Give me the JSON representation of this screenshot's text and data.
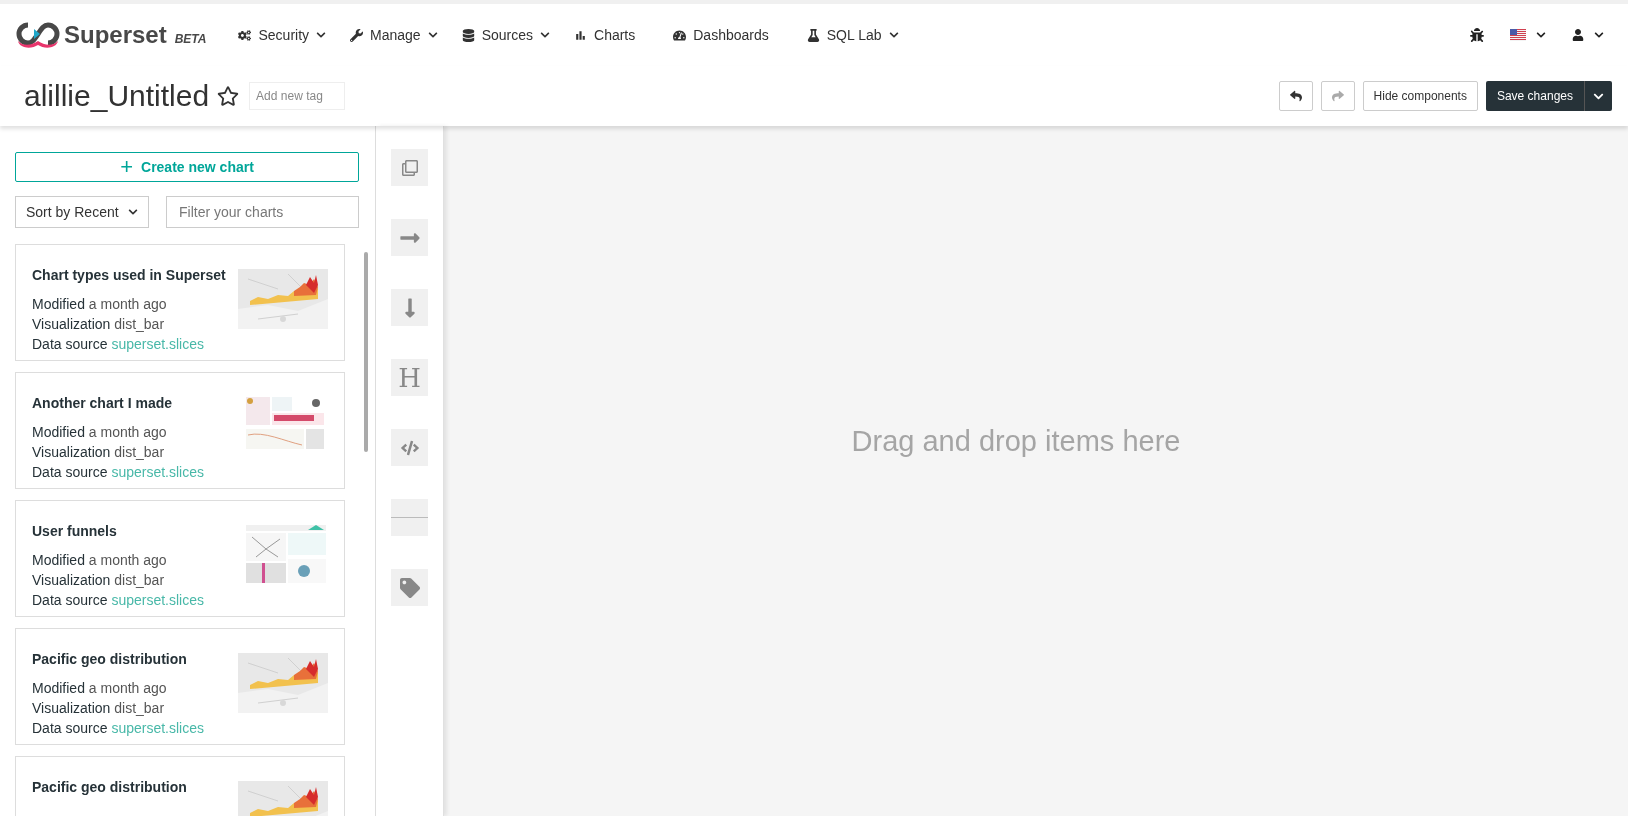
{
  "navbar": {
    "brand": "Superset",
    "badge": "BETA",
    "items": [
      {
        "label": "Security",
        "dropdown": true
      },
      {
        "label": "Manage",
        "dropdown": true
      },
      {
        "label": "Sources",
        "dropdown": true
      },
      {
        "label": "Charts",
        "dropdown": false
      },
      {
        "label": "Dashboards",
        "dropdown": false
      },
      {
        "label": "SQL Lab",
        "dropdown": true
      }
    ]
  },
  "header": {
    "title": "alillie_Untitled",
    "starred": false,
    "tag_placeholder": "Add new tag",
    "undo_disabled": false,
    "redo_disabled": true,
    "hide_button": "Hide components",
    "save_button": "Save changes"
  },
  "chart_panel": {
    "create_button": "Create new chart",
    "create_icon": "+",
    "sort": "Sort by Recent",
    "filter_placeholder": "Filter your charts",
    "cards": [
      {
        "title": "Chart types used in Superset",
        "modified_label": "Modified",
        "modified": "a month ago",
        "viz_label": "Visualization",
        "viz": "dist_bar",
        "source_label": "Data source",
        "source": "superset.slices"
      },
      {
        "title": "Another chart I made",
        "modified_label": "Modified",
        "modified": "a month ago",
        "viz_label": "Visualization",
        "viz": "dist_bar",
        "source_label": "Data source",
        "source": "superset.slices"
      },
      {
        "title": "User funnels",
        "modified_label": "Modified",
        "modified": "a month ago",
        "viz_label": "Visualization",
        "viz": "dist_bar",
        "source_label": "Data source",
        "source": "superset.slices"
      },
      {
        "title": "Pacific geo distribution",
        "modified_label": "Modified",
        "modified": "a month ago",
        "viz_label": "Visualization",
        "viz": "dist_bar",
        "source_label": "Data source",
        "source": "superset.slices"
      },
      {
        "title": "Pacific geo distribution"
      }
    ]
  },
  "tools": [
    {
      "kind": "tabs"
    },
    {
      "kind": "row"
    },
    {
      "kind": "column"
    },
    {
      "kind": "header",
      "glyph": "H"
    },
    {
      "kind": "markdown"
    },
    {
      "kind": "divider"
    },
    {
      "kind": "tag"
    }
  ],
  "canvas": {
    "placeholder": "Drag and drop items here"
  }
}
